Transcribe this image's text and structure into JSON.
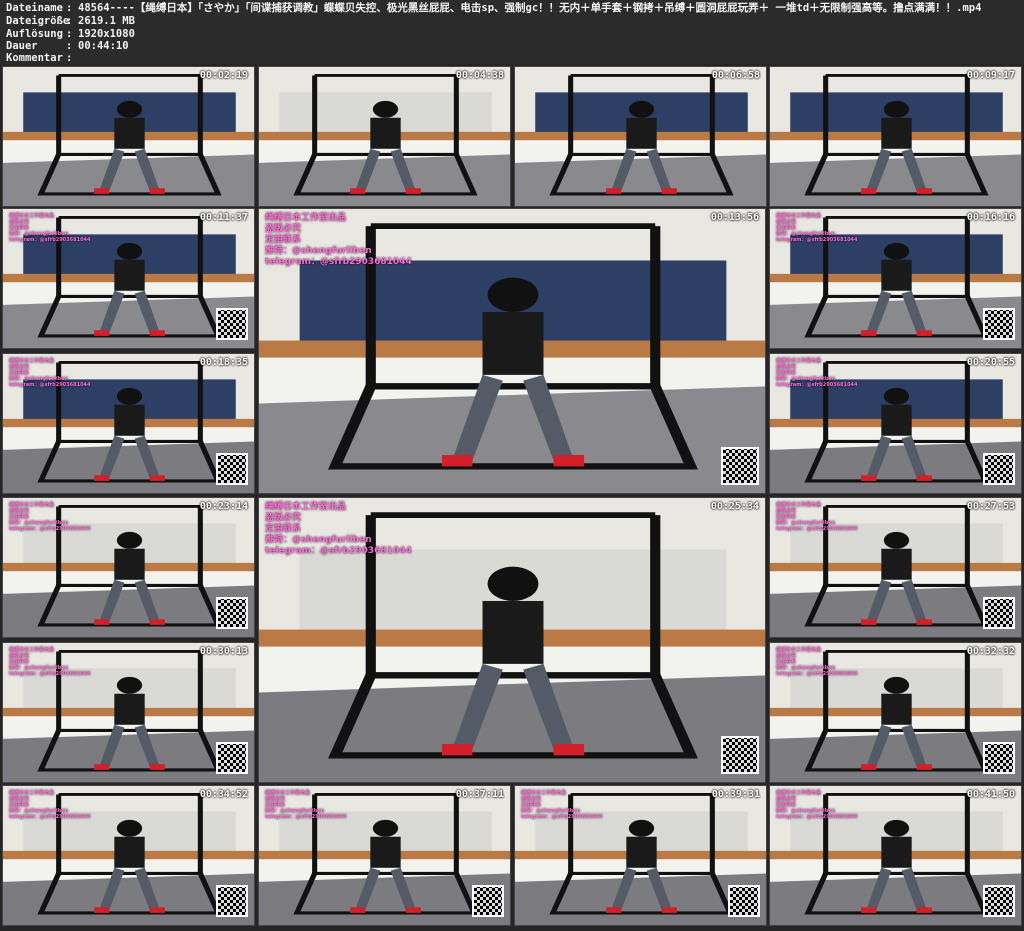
{
  "meta": [
    {
      "key": "Dateiname",
      "value": "48564----【绳缚日本】「さやか」「间谍捕获调教」蝶蝶贝失控、极光黑丝屁屁、电击sp、强制gc！！无内＋单手套＋钢拷＋吊缚＋圆洞屁屁玩弄＋ 一堆td＋无限制强高等。撸点满满！！.mp4"
    },
    {
      "key": "Dateigröße",
      "value": "2619.1 MB"
    },
    {
      "key": "Auflösung",
      "value": "1920x1080"
    },
    {
      "key": "Dauer",
      "value": "00:44:10"
    },
    {
      "key": "Kommentar",
      "value": ""
    }
  ],
  "separator": ":",
  "timestamps": [
    "00:02:19",
    "00:04:38",
    "00:06:58",
    "00:09:17",
    "00:11:37",
    "00:13:56",
    "00:16:16",
    "00:18:35",
    "00:20:55",
    "00:23:14",
    "00:25:34",
    "00:27:53",
    "00:30:13",
    "00:32:32",
    "00:34:52",
    "00:37:11",
    "00:39:31",
    "00:41:50"
  ],
  "watermark": {
    "line1": "绳缚日本工作室出品",
    "line2": "盗版必究",
    "line3": "定拍联系",
    "line4": "推特：@shengfurliben",
    "line5": "telegram：@sfrb2903681044"
  },
  "colors": {
    "background": "#262626",
    "text": "#f2f2f2",
    "watermark": "#ff6bd5"
  }
}
